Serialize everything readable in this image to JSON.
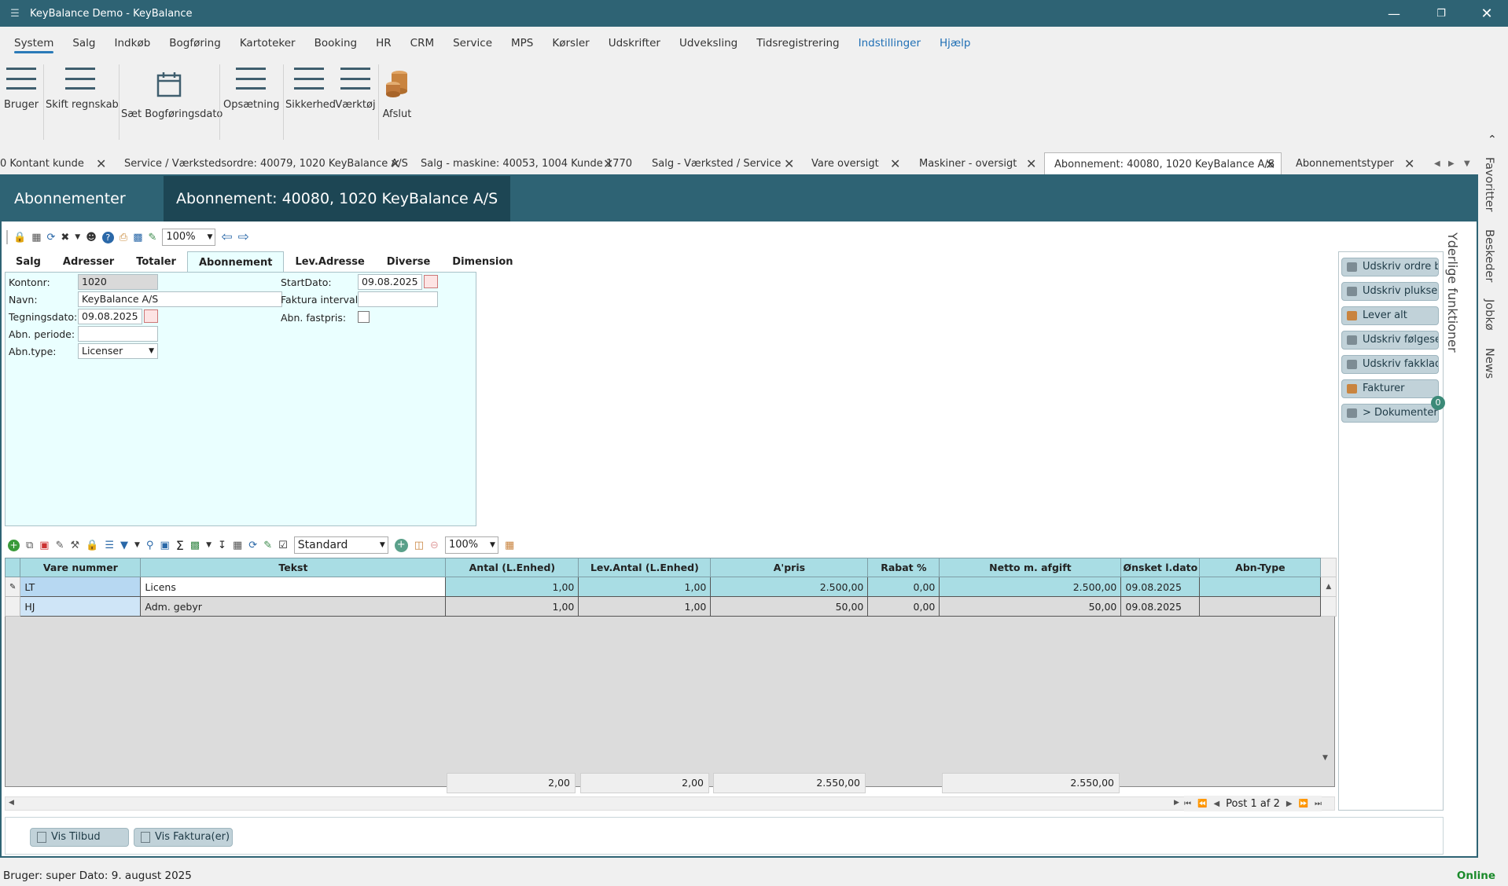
{
  "window": {
    "title": "KeyBalance Demo - KeyBalance"
  },
  "menu": [
    "System",
    "Salg",
    "Indkøb",
    "Bogføring",
    "Kartoteker",
    "Booking",
    "HR",
    "CRM",
    "Service",
    "MPS",
    "Kørsler",
    "Udskrifter",
    "Udveksling",
    "Tidsregistrering",
    "Indstillinger",
    "Hjælp"
  ],
  "ribbon": [
    "Bruger",
    "Skift regnskab",
    "Sæt Bogføringsdato",
    "Opsætning",
    "Sikkerhed",
    "Værktøj",
    "Afslut"
  ],
  "doc_tabs": [
    "0 Kontant kunde",
    "Service / Værkstedsordre: 40079, 1020 KeyBalance A/S",
    "Salg - maskine: 40053, 1004 Kunde 1770",
    "Salg - Værksted / Service",
    "Vare oversigt",
    "Maskiner - oversigt",
    "Abonnement: 40080, 1020 KeyBalance A/S",
    "Abonnementstyper"
  ],
  "side_tabs": [
    "Favoritter",
    "Beskeder",
    "Jobkø",
    "News"
  ],
  "breadcrumb": {
    "parent": "Abonnementer",
    "sep": ">>",
    "current": "Abonnement: 40080, 1020 KeyBalance A/S"
  },
  "zoom": "100%",
  "form_tabs": [
    "Salg",
    "Adresser",
    "Totaler",
    "Abonnement",
    "Lev.Adresse",
    "Diverse",
    "Dimension"
  ],
  "form": {
    "kontonr_label": "Kontonr:",
    "kontonr": "1020",
    "navn_label": "Navn:",
    "navn": "KeyBalance A/S",
    "tegning_label": "Tegningsdato:",
    "tegning": "09.08.2025",
    "periode_label": "Abn. periode:",
    "periode": "",
    "type_label": "Abn.type:",
    "type": "Licenser",
    "start_label": "StartDato:",
    "start": "09.08.2025",
    "interval_label": "Faktura interval:",
    "interval": "",
    "fastpris_label": "Abn. fastpris:"
  },
  "side_title": "Yderlige funktioner",
  "side_buttons": [
    "Udskriv ordre be",
    "Udskriv pluksedd",
    "Lever alt",
    "Udskriv følgesed",
    "Udskriv fakkladd",
    "Fakturer",
    "> Dokumenter"
  ],
  "doc_badge": "0",
  "grid_toolbar": {
    "view": "Standard",
    "zoom": "100%"
  },
  "columns": [
    "Vare nummer",
    "Tekst",
    "Antal (L.Enhed)",
    "Lev.Antal (L.Enhed)",
    "A'pris",
    "Rabat %",
    "Netto m. afgift",
    "Ønsket l.dato",
    "Abn-Type"
  ],
  "rows": [
    {
      "vare": "LT",
      "tekst": "Licens",
      "antal": "1,00",
      "lev": "1,00",
      "apris": "2.500,00",
      "rabat": "0,00",
      "netto": "2.500,00",
      "dato": "09.08.2025",
      "type": ""
    },
    {
      "vare": "HJ",
      "tekst": "Adm. gebyr",
      "antal": "1,00",
      "lev": "1,00",
      "apris": "50,00",
      "rabat": "0,00",
      "netto": "50,00",
      "dato": "09.08.2025",
      "type": ""
    }
  ],
  "totals": {
    "antal": "2,00",
    "lev": "2,00",
    "apris": "2.550,00",
    "netto": "2.550,00"
  },
  "pager": "Post 1 af 2",
  "bottom_buttons": [
    "Vis Tilbud",
    "Vis Faktura(er)"
  ],
  "status": {
    "user": "Bruger:  super  Dato:  9. august 2025",
    "online": "Online"
  }
}
